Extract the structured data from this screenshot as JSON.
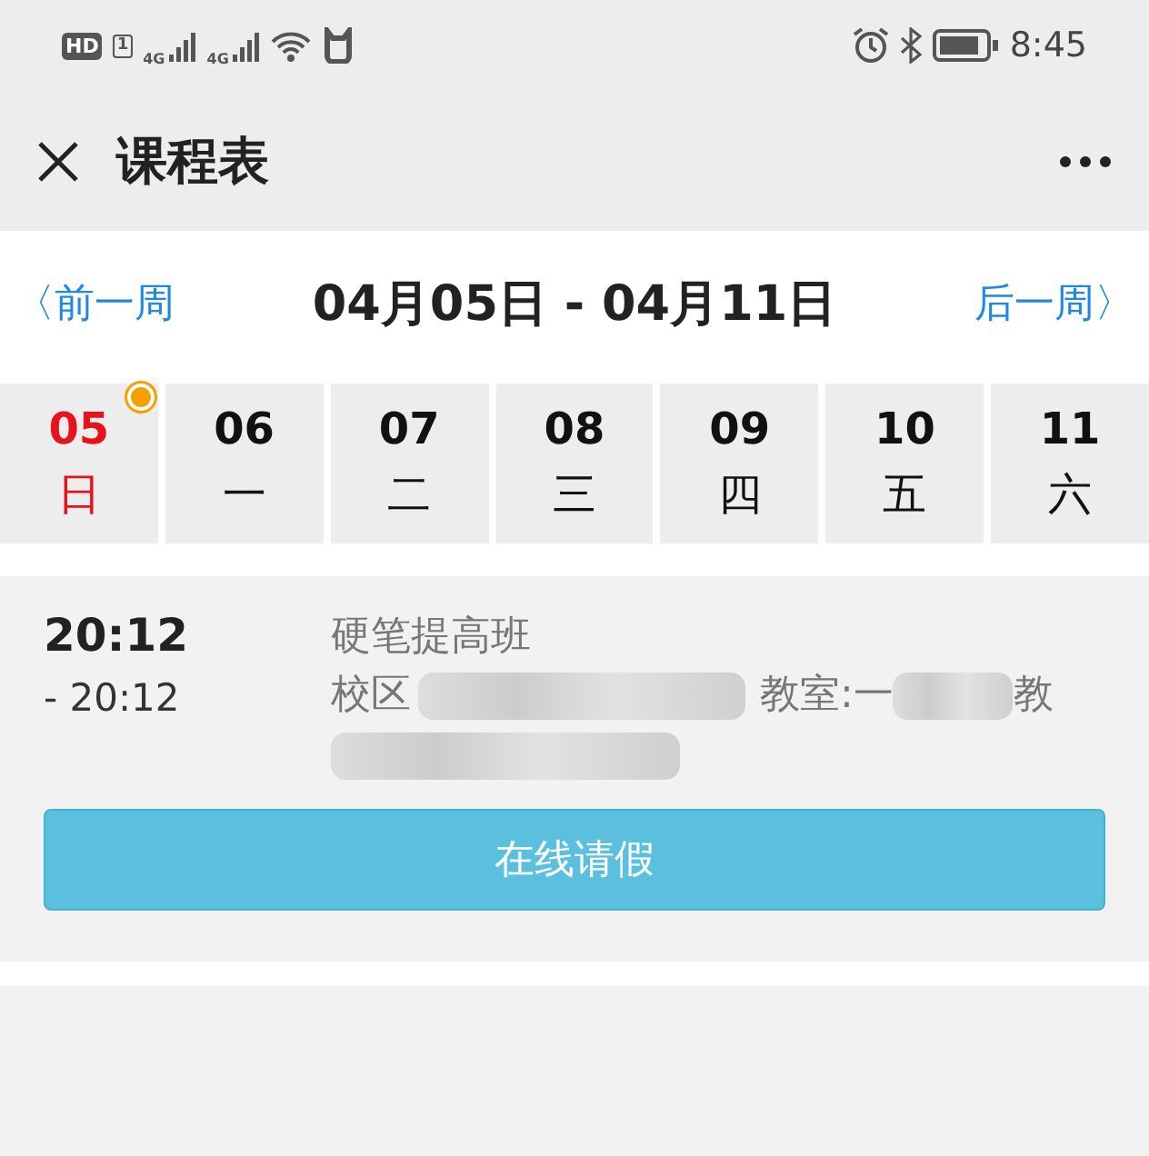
{
  "status_bar": {
    "hd": "HD",
    "sim": "1",
    "network_1": "4G",
    "network_2": "4G",
    "time": "8:45"
  },
  "header": {
    "title": "课程表"
  },
  "week_nav": {
    "prev": "〈前一周",
    "range": "04月05日 - 04月11日",
    "next": "后一周〉"
  },
  "days": [
    {
      "date": "05",
      "weekday": "日",
      "selected": true,
      "has_lesson": true
    },
    {
      "date": "06",
      "weekday": "一",
      "selected": false,
      "has_lesson": false
    },
    {
      "date": "07",
      "weekday": "二",
      "selected": false,
      "has_lesson": false
    },
    {
      "date": "08",
      "weekday": "三",
      "selected": false,
      "has_lesson": false
    },
    {
      "date": "09",
      "weekday": "四",
      "selected": false,
      "has_lesson": false
    },
    {
      "date": "10",
      "weekday": "五",
      "selected": false,
      "has_lesson": false
    },
    {
      "date": "11",
      "weekday": "六",
      "selected": false,
      "has_lesson": false
    }
  ],
  "lessons": [
    {
      "start": "20:12",
      "end": "- 20:12",
      "name": "硬笔提高班",
      "campus_label": "校区",
      "room_label": "教室:一",
      "room_tail": "教",
      "leave_button": "在线请假"
    }
  ]
}
